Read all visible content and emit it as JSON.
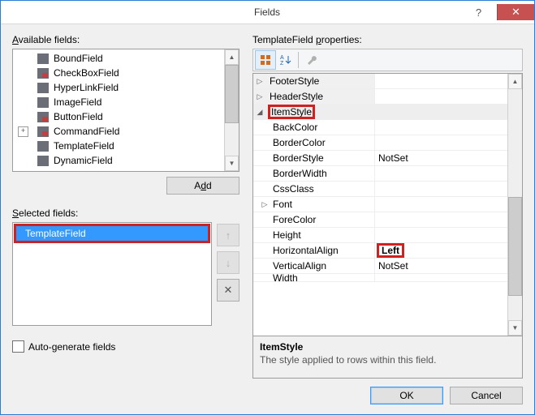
{
  "window": {
    "title": "Fields"
  },
  "left": {
    "available_label": "Available fields:",
    "available_label_ul": "A",
    "fields": [
      {
        "name": "BoundField",
        "icon": "field-icon"
      },
      {
        "name": "CheckBoxField",
        "icon": "field-check-icon"
      },
      {
        "name": "HyperLinkField",
        "icon": "field-link-icon"
      },
      {
        "name": "ImageField",
        "icon": "field-image-icon"
      },
      {
        "name": "ButtonField",
        "icon": "field-button-icon"
      },
      {
        "name": "CommandField",
        "icon": "field-command-icon",
        "expandable": true
      },
      {
        "name": "TemplateField",
        "icon": "field-template-icon"
      },
      {
        "name": "DynamicField",
        "icon": "field-dynamic-icon"
      }
    ],
    "add_label": "Add",
    "add_label_ul": "d",
    "selected_label": "Selected fields:",
    "selected_label_ul": "S",
    "selected_item": "TemplateField",
    "autogen_label": "Auto-generate fields",
    "autogen_label_ul": "g"
  },
  "right": {
    "properties_label": "TemplateField properties:",
    "properties_label_ul": "p",
    "rows": [
      {
        "kind": "group",
        "name": "FooterStyle",
        "exp": "▷"
      },
      {
        "kind": "group",
        "name": "HeaderStyle",
        "exp": "▷"
      },
      {
        "kind": "groupsel",
        "name": "ItemStyle",
        "exp": "◢"
      },
      {
        "kind": "prop",
        "name": "BackColor",
        "value": ""
      },
      {
        "kind": "prop",
        "name": "BorderColor",
        "value": ""
      },
      {
        "kind": "prop",
        "name": "BorderStyle",
        "value": "NotSet"
      },
      {
        "kind": "prop",
        "name": "BorderWidth",
        "value": ""
      },
      {
        "kind": "prop",
        "name": "CssClass",
        "value": ""
      },
      {
        "kind": "propexp",
        "name": "Font",
        "value": "",
        "exp": "▷"
      },
      {
        "kind": "prop",
        "name": "ForeColor",
        "value": ""
      },
      {
        "kind": "prop",
        "name": "Height",
        "value": ""
      },
      {
        "kind": "propsel",
        "name": "HorizontalAlign",
        "value": "Left"
      },
      {
        "kind": "prop",
        "name": "VerticalAlign",
        "value": "NotSet"
      },
      {
        "kind": "prop",
        "name": "Width",
        "value": ""
      }
    ],
    "desc_title": "ItemStyle",
    "desc_text": "The style applied to rows within this field."
  },
  "buttons": {
    "ok": "OK",
    "cancel": "Cancel"
  },
  "icons": {
    "help": "?",
    "close": "✕",
    "up": "↑",
    "down": "↓",
    "delete": "✕",
    "sb_up": "▲",
    "sb_down": "▼"
  }
}
